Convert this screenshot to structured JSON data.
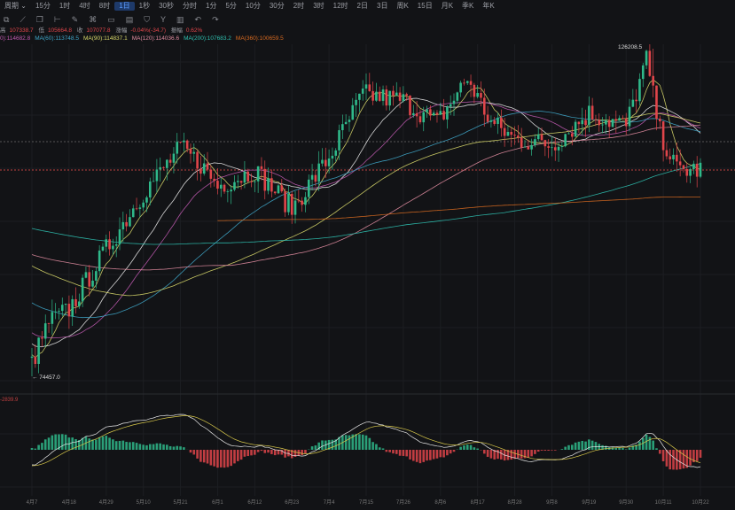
{
  "toolbar": {
    "period_label": "周期 ⌄",
    "intervals": [
      "15分",
      "1时",
      "4时",
      "8时",
      "1日",
      "1秒",
      "30秒",
      "分时",
      "1分",
      "5分",
      "10分",
      "30分",
      "2时",
      "3时",
      "12时",
      "2日",
      "3日",
      "周K",
      "15日",
      "月K",
      "季K",
      "年K"
    ],
    "active": "1日"
  },
  "drawing_tools": [
    "layers-icon",
    "line-icon",
    "copy-icon",
    "ruler-icon",
    "brush-icon",
    "pattern-icon",
    "box-icon",
    "note-icon",
    "tag-icon",
    "filter-icon",
    "trash-icon",
    "undo-icon",
    "redo-icon"
  ],
  "ohlc": {
    "high_label": "高",
    "high": "107338.7",
    "low_label": "低",
    "low": "105664.8",
    "close_label": "收",
    "close": "107077.8",
    "change_label": "涨幅",
    "change": "-0.04%(-34.7)",
    "amp_label": "振幅",
    "amp": "0.62%"
  },
  "ma": [
    {
      "label": "0):114682.8",
      "color": "#c05ab0"
    },
    {
      "label": "MA(60):113748.5",
      "color": "#3fa6c8"
    },
    {
      "label": "MA(90):114837.1",
      "color": "#d8d86a"
    },
    {
      "label": "MA(120):114036.6",
      "color": "#e08ca0"
    },
    {
      "label": "MA(200):107683.2",
      "color": "#2fc0b0"
    },
    {
      "label": "MA(360):100659.5",
      "color": "#d86a20"
    }
  ],
  "annotations": {
    "high": "126208.5",
    "low": "← 74457.0"
  },
  "macd_label": "-2839.9",
  "colors": {
    "up": "#2fb98a",
    "down": "#e0454a",
    "bg": "#121316"
  },
  "chart_data": {
    "type": "candlestick",
    "x_labels": [
      "4月7",
      "4月18",
      "4月29",
      "5月10",
      "5月21",
      "6月1",
      "6月12",
      "6月23",
      "7月4",
      "7月15",
      "7月26",
      "8月6",
      "8月17",
      "8月28",
      "9月8",
      "9月19",
      "9月30",
      "10月11",
      "10月22"
    ],
    "keypoints_day": [
      0,
      5,
      11,
      22,
      33,
      44,
      50,
      55,
      66,
      77,
      88,
      98,
      110,
      120,
      129,
      136,
      143,
      154,
      165,
      176,
      182,
      186,
      191,
      198
    ],
    "keypoints_close": [
      76500,
      83000,
      85000,
      94500,
      103500,
      110500,
      108000,
      104500,
      107000,
      101000,
      109000,
      119000,
      118000,
      114500,
      121500,
      114500,
      112000,
      111000,
      116000,
      114000,
      124500,
      113000,
      107000,
      107100
    ],
    "high": 126208.5,
    "low": 74457.0,
    "ylim": [
      60000,
      128000
    ]
  }
}
